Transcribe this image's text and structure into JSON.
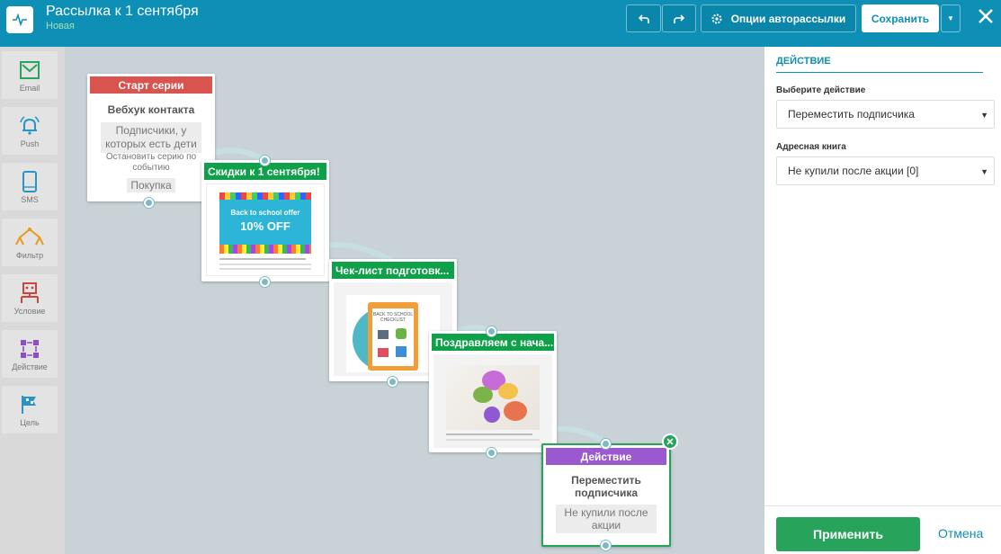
{
  "header": {
    "title": "Рассылка к 1 сентября",
    "status": "Новая",
    "options_label": "Опции авторассылки",
    "save_label": "Сохранить"
  },
  "sidebar": {
    "items": [
      {
        "label": "Email",
        "icon": "envelope-icon"
      },
      {
        "label": "Push",
        "icon": "bell-icon"
      },
      {
        "label": "SMS",
        "icon": "phone-icon"
      },
      {
        "label": "Фильтр",
        "icon": "filter-icon"
      },
      {
        "label": "Условие",
        "icon": "condition-icon"
      },
      {
        "label": "Действие",
        "icon": "action-icon"
      },
      {
        "label": "Цель",
        "icon": "flag-icon"
      }
    ]
  },
  "nodes": {
    "start": {
      "header": "Старт серии",
      "title": "Вебхук контакта",
      "tag": "Подписчики, у которых есть дети",
      "stop_label": "Остановить серию по событию",
      "event": "Покупка"
    },
    "email1": {
      "header": "Скидки к 1 сентября!",
      "banner_line1": "Back to school offer",
      "banner_line2": "10% OFF"
    },
    "email2": {
      "header": "Чек-лист подготовк...",
      "clipboard_text": "BACK TO SCHOOL CHECKLIST"
    },
    "email3": {
      "header": "Поздравляем с нача..."
    },
    "action": {
      "header": "Действие",
      "title": "Переместить подписчика",
      "tag": "Не купили после акции"
    }
  },
  "panel": {
    "section_title": "ДЕЙСТВИЕ",
    "action_label": "Выберите действие",
    "action_value": "Переместить подписчика",
    "book_label": "Адресная книга",
    "book_value": "Не купили после акции [0]",
    "apply_label": "Применить",
    "cancel_label": "Отмена"
  },
  "colors": {
    "topbar": "#0e8fb6",
    "start_header": "#d9534f",
    "email_header": "#0fa04a",
    "action_header": "#9b59d0",
    "apply": "#27a35b"
  }
}
